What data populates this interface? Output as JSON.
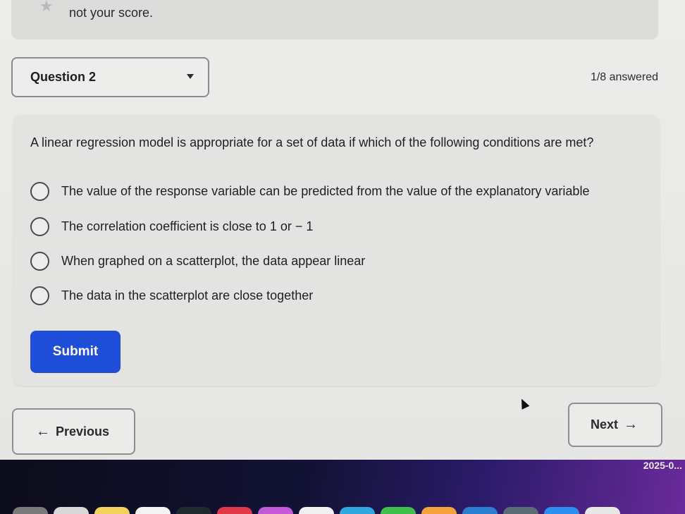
{
  "notice": {
    "text": "not your score."
  },
  "question_selector": {
    "label": "Question 2"
  },
  "progress": {
    "answered_text": "1/8 answered"
  },
  "question": {
    "prompt": "A linear regression model is appropriate for a set of data if which of the following conditions are met?",
    "options": [
      "The value of the response variable can be predicted from the value of the explanatory variable",
      "The correlation coefficient is close to 1 or − 1",
      "When graphed on a scatterplot, the data appear linear",
      "The data in the scatterplot are close together"
    ],
    "submit_label": "Submit"
  },
  "navigation": {
    "previous_label": "Previous",
    "next_label": "Next"
  },
  "taskbar": {
    "datetime": "2025-0..."
  },
  "colors": {
    "primary_button": "#1f4fd8",
    "card_background": "#e3e3e1",
    "page_background": "#ececea"
  }
}
